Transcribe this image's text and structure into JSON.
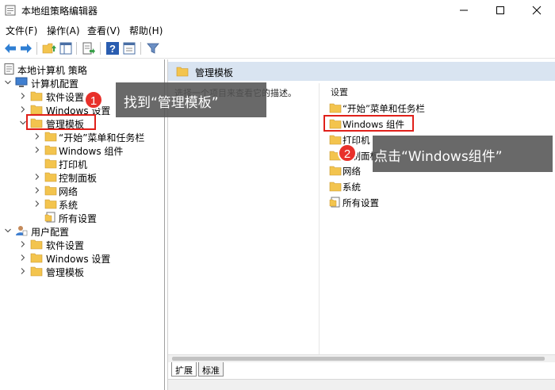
{
  "window": {
    "title": "本地组策略编辑器"
  },
  "menu": {
    "items": [
      "文件(F)",
      "操作(A)",
      "查看(V)",
      "帮助(H)"
    ]
  },
  "toolbar": {
    "buttons": [
      "back-arrow-icon",
      "forward-arrow-icon",
      "up-folder-icon",
      "show-hide-tree-icon",
      "export-list-icon",
      "help-icon",
      "properties-icon",
      "filter-icon"
    ]
  },
  "tree": {
    "root": "本地计算机 策略",
    "computer": "计算机配置",
    "computer_children": [
      "软件设置",
      "Windows 设置",
      "管理模板"
    ],
    "admin_children": [
      "“开始”菜单和任务栏",
      "Windows 组件",
      "打印机",
      "控制面板",
      "网络",
      "系统",
      "所有设置"
    ],
    "user": "用户配置",
    "user_children": [
      "软件设置",
      "Windows 设置",
      "管理模板"
    ]
  },
  "right": {
    "header_title": "管理模板",
    "description": "选择一个项目来查看它的描述。",
    "column_header": "设置",
    "items": [
      "“开始”菜单和任务栏",
      "Windows 组件",
      "打印机",
      "控制面板",
      "网络",
      "系统",
      "所有设置"
    ],
    "tabs": [
      "扩展",
      "标准"
    ]
  },
  "callouts": [
    {
      "number": "1",
      "text": "找到“管理模板”"
    },
    {
      "number": "2",
      "text": "点击“Windows组件”"
    }
  ],
  "colors": {
    "folder": "#f3c44e",
    "accent": "#e8302a",
    "header": "#d9e4f1"
  }
}
